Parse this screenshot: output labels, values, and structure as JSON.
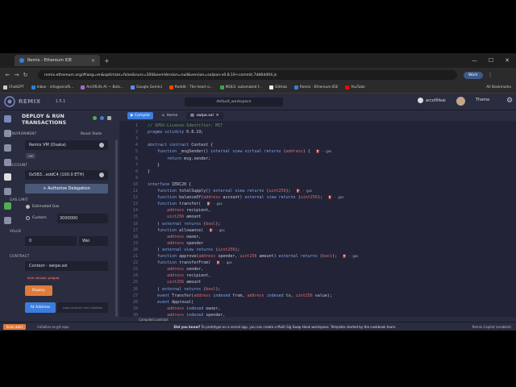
{
  "browser": {
    "tab_title": "Remix - Ethereum IDE",
    "url": "remix.ethereum.org/#lang=en&optimize=false&runs=200&evmVersion=null&version=soljson-v0.8.19+commit.7dd6d404.js",
    "profile_label": "Work",
    "bookmarks": [
      "ChatGPT",
      "Inbox - info@arcofli...",
      "ArcOfLife AI — Bots...",
      "Google Gemini",
      "Reddit - The heart o...",
      "MQLS: automated f...",
      "GitHub",
      "Remix - Ethereum IDE",
      "YouTube"
    ],
    "all_bookmarks": "All Bookmarks"
  },
  "remix": {
    "brand": "REMIX",
    "version": "1.5.1",
    "workspace": "default_workspace",
    "github_user": "arcoflifeai",
    "theme_label": "Theme"
  },
  "panel": {
    "title": "DEPLOY & RUN TRANSACTIONS",
    "environment_label": "ENVIRONMENT",
    "reset_label": "Reset State",
    "environment_value": "Remix VM (Osaka)",
    "vm_badge": "VM",
    "account_label": "ACCOUNT",
    "account_value": "0x5B3...eddC4 (100.0 ETH)",
    "authorize_label": "Authorize Delegation",
    "gas_limit_label": "GAS LIMIT",
    "estimated_gas": "Estimated Gas",
    "custom_label": "Custom",
    "gas_value": "3000000",
    "value_label": "VALUE",
    "value_amount": "0",
    "value_unit": "Wei",
    "contract_label": "CONTRACT",
    "contract_value": "Context - swipe.sol",
    "evm_badge": "evm version: prague",
    "deploy_label": "Deploy",
    "at_address_label": "At Address",
    "load_address_label": "Load contract from Address"
  },
  "editor": {
    "compile_label": "Compile",
    "tabs": [
      "Home",
      "swipe.sol"
    ],
    "gas_label": "gas",
    "compile_bar": "Compiled contract"
  },
  "statusbar": {
    "scan_label": "Scan alert",
    "mid_label": "Initialize as git repo",
    "hint_bold": "Did you know?",
    "hint_text": "To prototype on a vercel app, you can create a Multi Sig Swap Hook workspace. Template started by the cookbook team.",
    "right_label": "Remix Copilot (enabled)"
  },
  "code_lines": [
    "// SPDX-License-Identifier: MIT",
    "pragma solidity 0.8.19;",
    "",
    "abstract contract Context {",
    "    function _msgSender() internal view virtual returns (address) {",
    "        return msg.sender;",
    "    }",
    "}",
    "",
    "interface IERC20 {",
    "    function totalSupply() external view returns (uint256);",
    "    function balanceOf(address account) external view returns (uint256);",
    "    function transfer(",
    "        address recipient,",
    "        uint256 amount",
    "    ) external returns (bool);",
    "    function allowance(",
    "        address owner,",
    "        address spender",
    "    ) external view returns (uint256);",
    "    function approve(address spender, uint256 amount) external returns (bool);",
    "    function transferFrom(",
    "        address sender,",
    "        address recipient,",
    "        uint256 amount",
    "    ) external returns (bool);",
    "    event Transfer(address indexed from, address indexed to, uint256 value);",
    "    event Approval(",
    "        address indexed owner,",
    "        address indexed spender,"
  ]
}
